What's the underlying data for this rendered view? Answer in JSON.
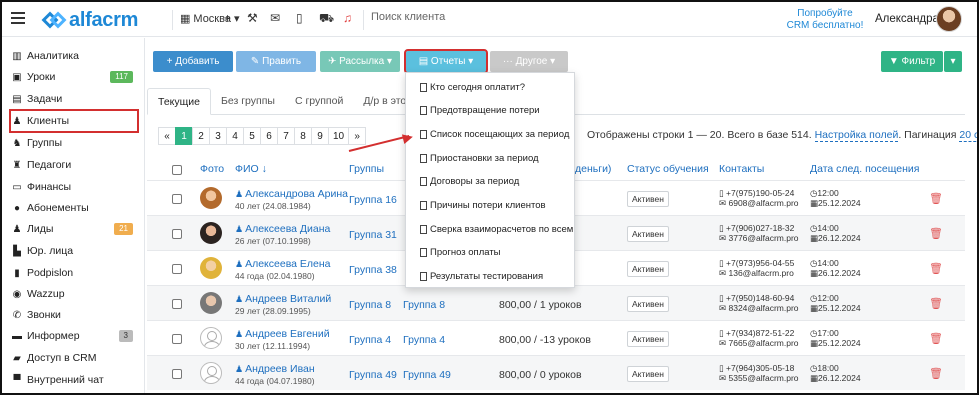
{
  "app": {
    "logo_text": "alfacrm",
    "city": "Москва",
    "search_placeholder": "Поиск клиента",
    "trial_line1": "Попробуйте",
    "trial_line2": "CRM бесплатно!",
    "user_name": "Александра"
  },
  "sidebar": {
    "items": [
      {
        "label": "Аналитика",
        "icon": "chart-icon",
        "badge": ""
      },
      {
        "label": "Уроки",
        "icon": "calendar-icon",
        "badge": "117"
      },
      {
        "label": "Задачи",
        "icon": "clipboard-icon",
        "badge": ""
      },
      {
        "label": "Клиенты",
        "icon": "user-icon",
        "badge": ""
      },
      {
        "label": "Группы",
        "icon": "users-icon",
        "badge": ""
      },
      {
        "label": "Педагоги",
        "icon": "teacher-icon",
        "badge": ""
      },
      {
        "label": "Финансы",
        "icon": "money-icon",
        "badge": ""
      },
      {
        "label": "Абонементы",
        "icon": "subscription-icon",
        "badge": ""
      },
      {
        "label": "Лиды",
        "icon": "leads-icon",
        "badge": "21"
      },
      {
        "label": "Юр. лица",
        "icon": "building-icon",
        "badge": ""
      },
      {
        "label": "Podpislon",
        "icon": "document-icon",
        "badge": ""
      },
      {
        "label": "Wazzup",
        "icon": "whatsapp-icon",
        "badge": ""
      },
      {
        "label": "Звонки",
        "icon": "phone-icon",
        "badge": ""
      },
      {
        "label": "Информер",
        "icon": "informer-icon",
        "badge": "3"
      },
      {
        "label": "Доступ в CRM",
        "icon": "lock-icon",
        "badge": ""
      },
      {
        "label": "Внутренний чат",
        "icon": "chat-icon",
        "badge": ""
      }
    ],
    "badge_colors": {
      "green": "#5cb85c",
      "orange": "#f0ad4e",
      "gray": "#bbbbbb"
    }
  },
  "toolbar": {
    "add": "+ Добавить",
    "edit": "✎ Править",
    "mail": "✈ Рассылка ▾",
    "reports": "▤ Отчеты ▾",
    "other": "··· Другое ▾",
    "filter": "▼ Фильтр",
    "filter_caret": "▾"
  },
  "tabs": [
    "Текущие",
    "Без группы",
    "С группой",
    "Д/р в этом м"
  ],
  "pager": {
    "prev": "«",
    "pages": [
      "1",
      "2",
      "3",
      "4",
      "5",
      "6",
      "7",
      "8",
      "9",
      "10"
    ],
    "next": "»"
  },
  "rows_info": {
    "text": "Отображены строки 1 — 20. Всего в базе 514.",
    "settings_link": "Настройка полей",
    "pagination_label": "Пагинация",
    "pagination_value": "20 строк"
  },
  "table": {
    "headers": {
      "photo": "Фото",
      "fio": "ФИО ↓",
      "groups": "Группы",
      "balance": "деньги)",
      "status": "Статус обучения",
      "contacts": "Контакты",
      "next_visit": "Дата след. посещения"
    },
    "rows": [
      {
        "name": "Александрова Арина",
        "age": "40 лет (24.08.1984)",
        "group1": "Группа 16",
        "group2": "",
        "balance": "",
        "status": "Активен",
        "phone": "+7(975)190-05-24",
        "email": "6908@alfacrm.pro",
        "time": "12:00",
        "date": "25.12.2024",
        "avatar": "photo"
      },
      {
        "name": "Алексеева Диана",
        "age": "26 лет (07.10.1998)",
        "group1": "Группа 31",
        "group2": "",
        "balance": "",
        "status": "Активен",
        "phone": "+7(906)027-18-32",
        "email": "3776@alfacrm.pro",
        "time": "14:00",
        "date": "26.12.2024",
        "avatar": "photo"
      },
      {
        "name": "Алексеева Елена",
        "age": "44 года (02.04.1980)",
        "group1": "Группа 38",
        "group2": "",
        "balance": "",
        "status": "Активен",
        "phone": "+7(973)956-04-55",
        "email": "136@alfacrm.pro",
        "time": "14:00",
        "date": "26.12.2024",
        "avatar": "photo"
      },
      {
        "name": "Андреев Виталий",
        "age": "29 лет (28.09.1995)",
        "group1": "Группа 8",
        "group2": "Группа 8",
        "balance": "800,00 / 1 уроков",
        "status": "Активен",
        "phone": "+7(950)148-60-94",
        "email": "8324@alfacrm.pro",
        "time": "12:00",
        "date": "25.12.2024",
        "avatar": "photo"
      },
      {
        "name": "Андреев Евгений",
        "age": "30 лет (12.11.1994)",
        "group1": "Группа 4",
        "group2": "Группа 4",
        "balance": "800,00 / -13 уроков",
        "status": "Активен",
        "phone": "+7(934)872-51-22",
        "email": "7665@alfacrm.pro",
        "time": "17:00",
        "date": "25.12.2024",
        "avatar": "blank"
      },
      {
        "name": "Андреев Иван",
        "age": "44 года (04.07.1980)",
        "group1": "Группа 49",
        "group2": "Группа 49",
        "balance": "800,00 / 0 уроков",
        "status": "Активен",
        "phone": "+7(964)305-05-18",
        "email": "5355@alfacrm.pro",
        "time": "18:00",
        "date": "26.12.2024",
        "avatar": "blank"
      }
    ]
  },
  "dropdown": {
    "items": [
      "Кто сегодня оплатит?",
      "Предотвращение потери",
      "Список посещающих за период",
      "Приостановки за период",
      "Договоры за период",
      "Причины потери клиентов",
      "Сверка взаиморасчетов по всем",
      "Прогноз оплаты",
      "Результаты тестирования"
    ]
  },
  "colors": {
    "accent": "#1e88d6",
    "link": "#1e6fbf",
    "highlight": "#d32f2f",
    "green": "#2fb486"
  }
}
